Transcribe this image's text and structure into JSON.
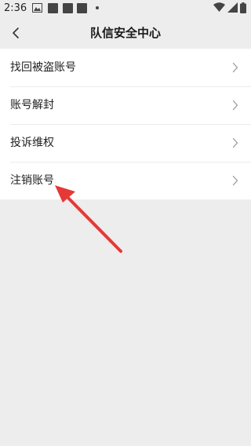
{
  "status_bar": {
    "time": "2:36"
  },
  "header": {
    "title": "队信安全中心",
    "back_icon": "chevron-left-icon"
  },
  "menu": {
    "items": [
      {
        "label": "找回被盗账号",
        "icon": "chevron-right-icon"
      },
      {
        "label": "账号解封",
        "icon": "chevron-right-icon"
      },
      {
        "label": "投诉维权",
        "icon": "chevron-right-icon"
      },
      {
        "label": "注销账号",
        "icon": "chevron-right-icon"
      }
    ]
  },
  "colors": {
    "background": "#ededed",
    "list_background": "#ffffff",
    "annotation_arrow": "#e53935"
  }
}
